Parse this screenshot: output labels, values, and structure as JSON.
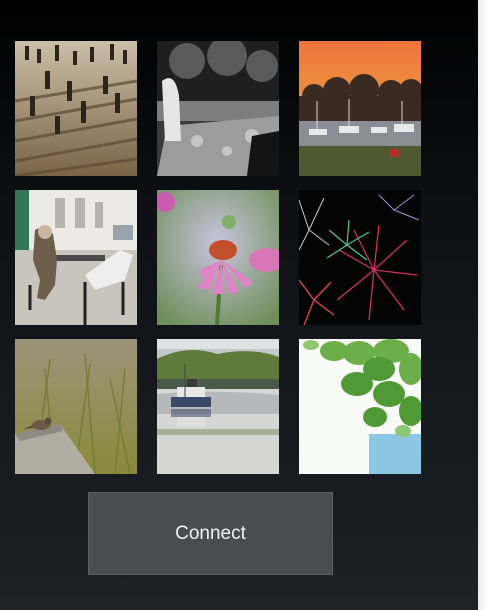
{
  "connect_button": {
    "label": "Connect"
  },
  "gallery": [
    {
      "id": "thumb-crowd-steps",
      "subject": "people-on-steps"
    },
    {
      "id": "thumb-bw-person",
      "subject": "black-and-white-park"
    },
    {
      "id": "thumb-harbor-sunset",
      "subject": "harbor-at-sunset"
    },
    {
      "id": "thumb-man-reading",
      "subject": "man-reading-on-bench"
    },
    {
      "id": "thumb-pink-flower",
      "subject": "pink-coneflower"
    },
    {
      "id": "thumb-fireworks",
      "subject": "fireworks"
    },
    {
      "id": "thumb-bird-grass",
      "subject": "bird-in-grass"
    },
    {
      "id": "thumb-boat-lake",
      "subject": "boat-on-lake"
    },
    {
      "id": "thumb-green-leaves",
      "subject": "green-leaves"
    }
  ],
  "colors": {
    "background_top": "#000000",
    "background_bottom": "#1d2227",
    "button_bg": "#4a4c4f",
    "button_text": "#f2f2f2"
  }
}
